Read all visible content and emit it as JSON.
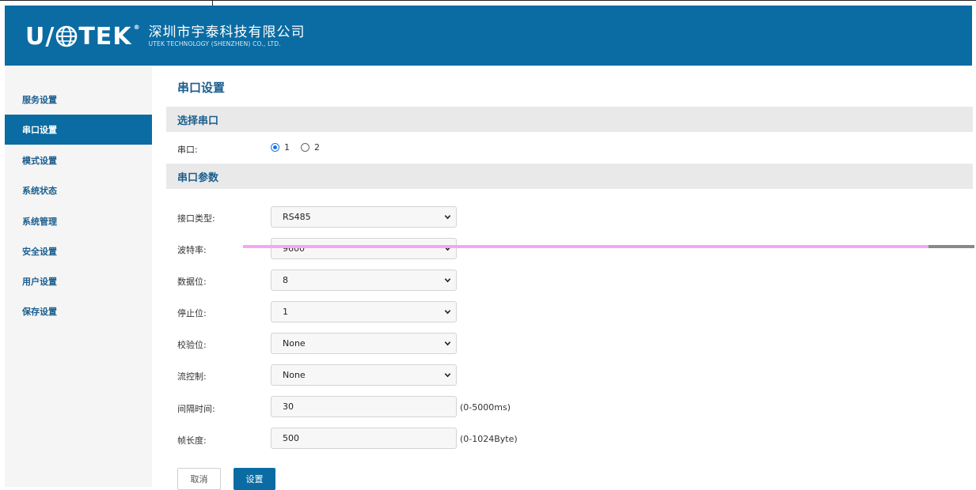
{
  "header": {
    "logo_text": "U TEK",
    "logo_reg": "®",
    "company_cn": "深圳市宇泰科技有限公司",
    "company_en": "UTEK TECHNOLOGY (SHENZHEN) CO., LTD.",
    "bg_color": "#0a6ca3"
  },
  "sidebar": {
    "items": [
      {
        "label": "服务设置",
        "active": false
      },
      {
        "label": "串口设置",
        "active": true
      },
      {
        "label": "模式设置",
        "active": false
      },
      {
        "label": "系统状态",
        "active": false
      },
      {
        "label": "系统管理",
        "active": false
      },
      {
        "label": "安全设置",
        "active": false
      },
      {
        "label": "用户设置",
        "active": false
      },
      {
        "label": "保存设置",
        "active": false
      }
    ]
  },
  "main": {
    "title": "串口设置",
    "section_select": "选择串口",
    "port_label": "串口:",
    "port_options": [
      "1",
      "2"
    ],
    "port_selected": "1",
    "section_params": "串口参数",
    "fields": {
      "interface_type": {
        "label": "接口类型:",
        "value": "RS485"
      },
      "baud_rate": {
        "label": "波特率:",
        "value": "9600"
      },
      "data_bits": {
        "label": "数据位:",
        "value": "8"
      },
      "stop_bits": {
        "label": "停止位:",
        "value": "1"
      },
      "parity": {
        "label": "校验位:",
        "value": "None"
      },
      "flow_control": {
        "label": "流控制:",
        "value": "None"
      },
      "interval": {
        "label": "间隔时间:",
        "value": "30",
        "hint": "(0-5000ms)"
      },
      "frame_length": {
        "label": "帧长度:",
        "value": "500",
        "hint": "(0-1024Byte)"
      }
    },
    "buttons": {
      "cancel": "取消",
      "set": "设置"
    }
  }
}
